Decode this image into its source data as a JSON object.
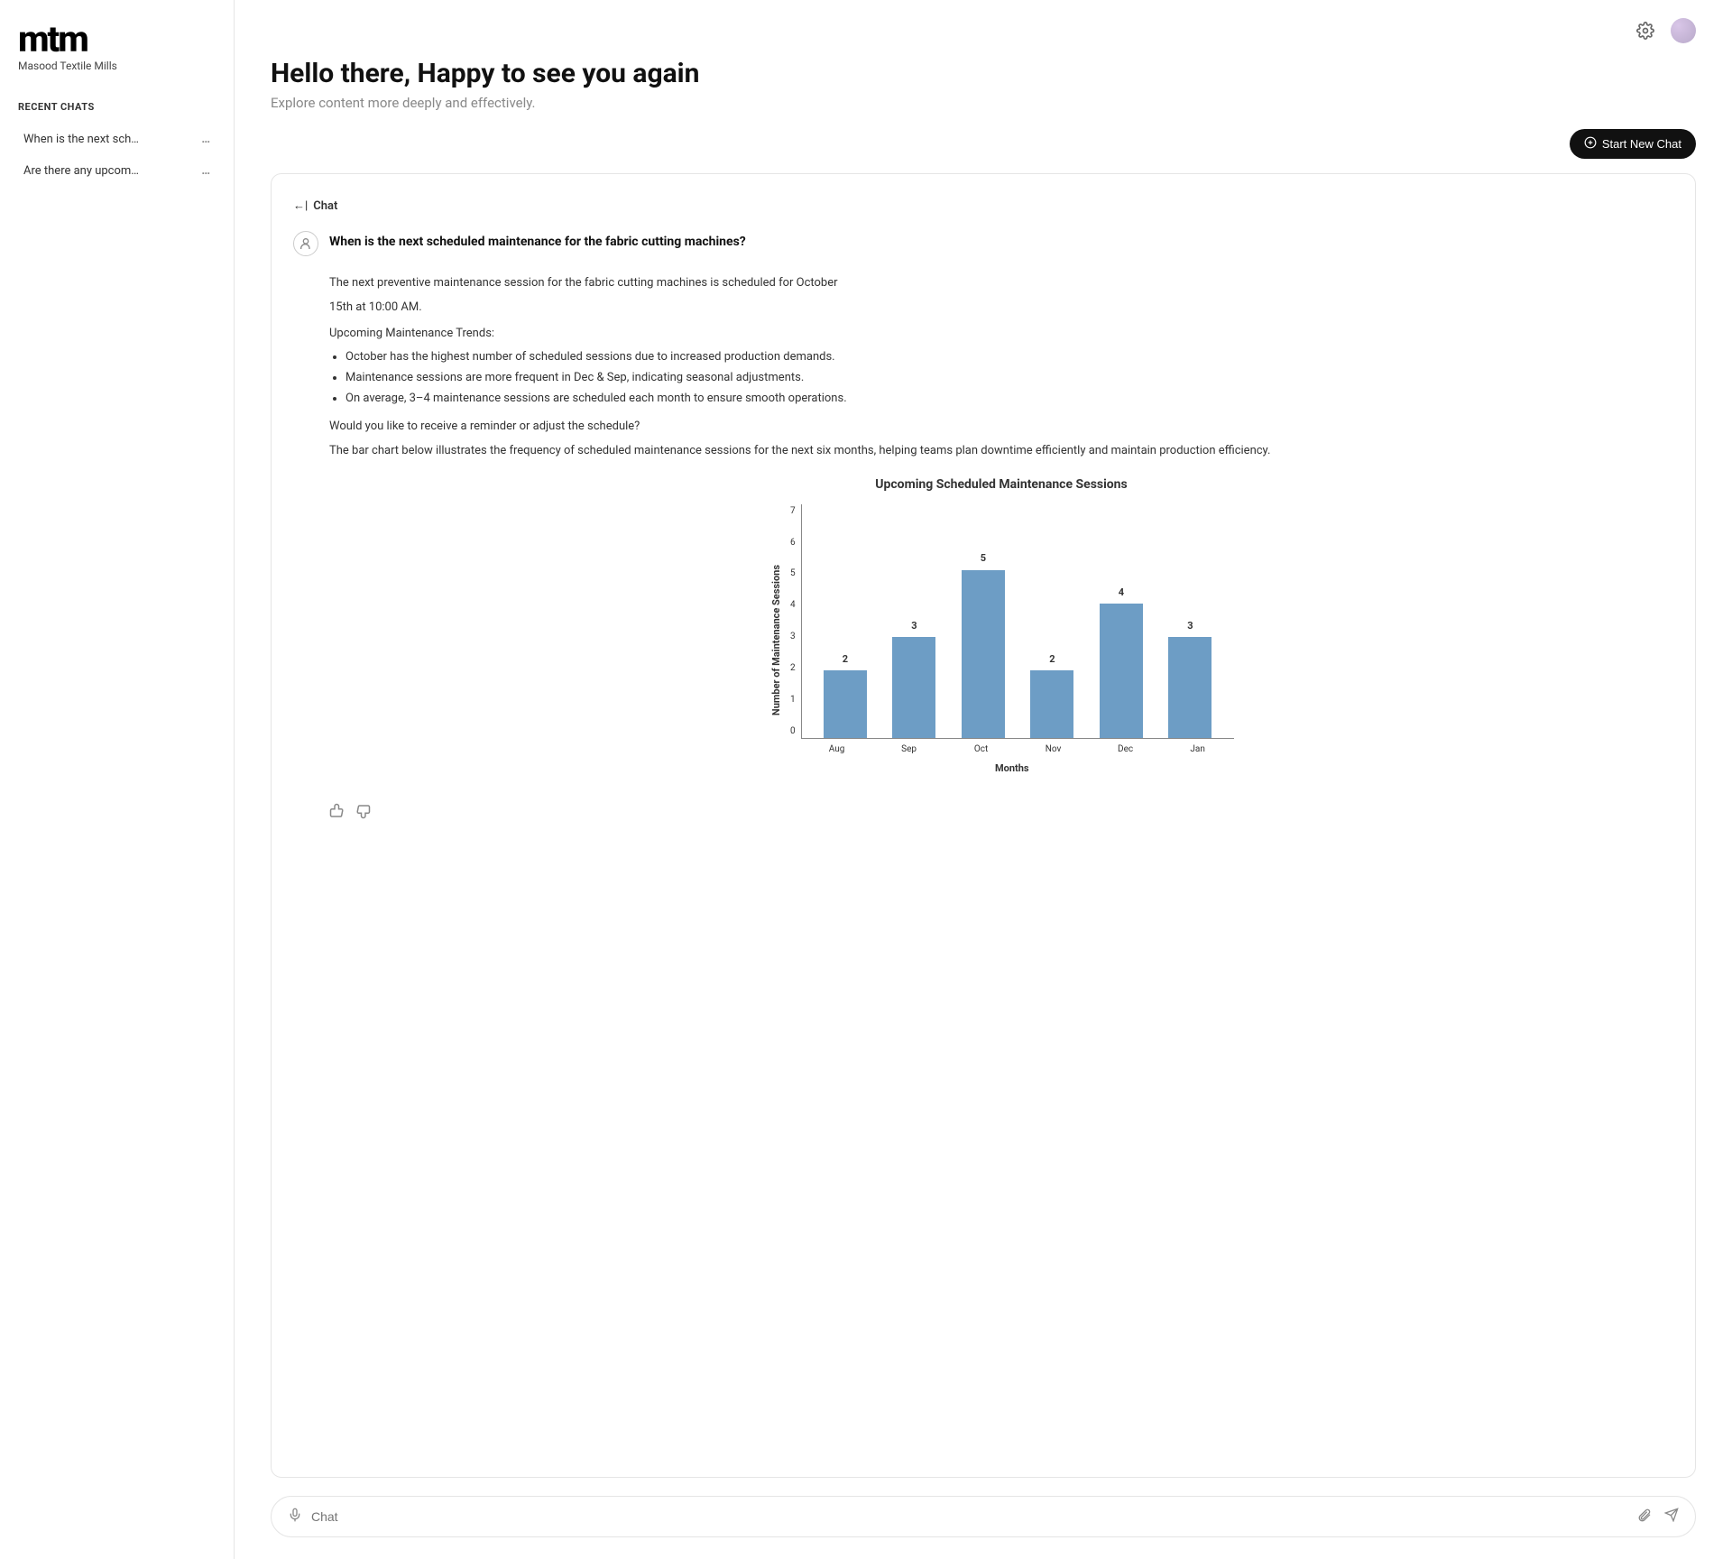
{
  "brand": {
    "logo": "mtm",
    "sub": "Masood Textile Mills"
  },
  "sidebar": {
    "recent_label": "RECENT CHATS",
    "items": [
      {
        "title": "When is the next sch…"
      },
      {
        "title": "Are there any upcom…"
      }
    ]
  },
  "topbar": {
    "new_chat_label": "Start New Chat"
  },
  "hero": {
    "title": "Hello there, Happy to see you again",
    "subtitle": "Explore content more deeply and effectively."
  },
  "chat": {
    "back_label": "Chat",
    "back_arrow": "←|",
    "user_question": "When is the next scheduled maintenance for the fabric cutting machines?",
    "answer": {
      "intro_line1": "The next preventive maintenance session for the fabric cutting machines is scheduled for October",
      "intro_line2": "15th at 10:00 AM.",
      "trends_heading": "Upcoming Maintenance Trends:",
      "bullets": [
        "October has the highest number of scheduled sessions due to increased production demands.",
        "Maintenance sessions are more frequent in Dec & Sep, indicating seasonal adjustments.",
        "On average, 3–4 maintenance sessions are scheduled each month to ensure smooth operations."
      ],
      "followup": "Would you like to receive a reminder or adjust the schedule?",
      "outro": "The bar chart below illustrates the frequency of scheduled maintenance sessions for the next six months, helping teams plan downtime efficiently and maintain production efficiency."
    }
  },
  "chart_data": {
    "type": "bar",
    "title": "Upcoming Scheduled Maintenance Sessions",
    "xlabel": "Months",
    "ylabel": "Number of Maintenance Sessions",
    "categories": [
      "Aug",
      "Sep",
      "Oct",
      "Nov",
      "Dec",
      "Jan"
    ],
    "values": [
      2,
      3,
      5,
      2,
      4,
      3
    ],
    "ylim": [
      0,
      7
    ],
    "yticks": [
      0,
      1,
      2,
      3,
      4,
      5,
      6,
      7
    ]
  },
  "composer": {
    "placeholder": "Chat"
  }
}
